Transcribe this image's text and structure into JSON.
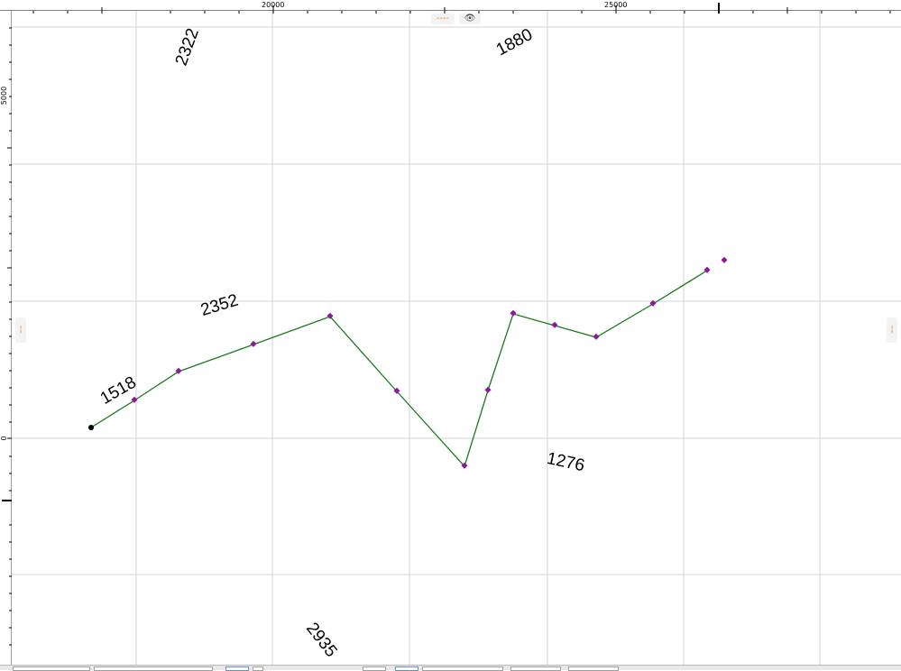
{
  "top_ruler": {
    "labels": [
      "20000",
      "25000"
    ]
  },
  "left_ruler": {
    "labels": [
      "5000",
      "0"
    ]
  },
  "page_controls": {
    "top_dash": "----",
    "top_eye": "👁",
    "left_dash": "¦",
    "right_dash": "¦"
  },
  "segment_labels": [
    "2322",
    "1880",
    "2352",
    "1518",
    "1276",
    "2935"
  ],
  "colors": {
    "line": "#1a7a1a",
    "vertex": "#8b1a9b",
    "start_point": "#000000",
    "grid": "#d3d3d3",
    "accent": "#f28a2a"
  }
}
